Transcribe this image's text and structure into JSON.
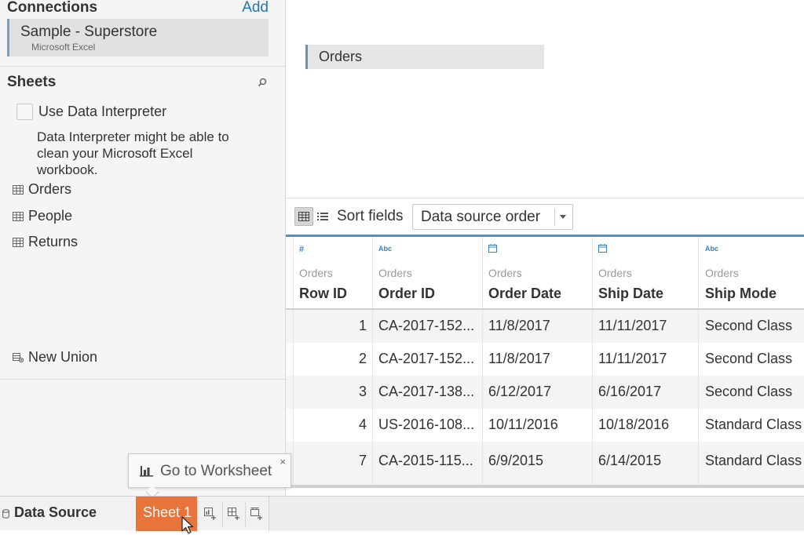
{
  "connections": {
    "title": "Connections",
    "add_label": "Add",
    "items": [
      {
        "name": "Sample - Superstore",
        "type": "Microsoft Excel"
      }
    ]
  },
  "sheets": {
    "title": "Sheets",
    "search_icon": "search-icon",
    "interpreter_label": "Use Data Interpreter",
    "interpreter_checked": false,
    "interpreter_desc": "Data Interpreter might be able to clean your Microsoft Excel workbook.",
    "items": [
      {
        "label": "Orders",
        "icon": "table-icon"
      },
      {
        "label": "People",
        "icon": "table-icon"
      },
      {
        "label": "Returns",
        "icon": "table-icon"
      }
    ],
    "new_union_label": "New Union"
  },
  "canvas": {
    "table_label": "Orders"
  },
  "grid_toolbar": {
    "sort_label": "Sort fields",
    "sort_value": "Data source order"
  },
  "grid": {
    "columns": [
      {
        "type_icon": "#",
        "source": "Orders",
        "name": "Row ID"
      },
      {
        "type_icon": "Abc",
        "source": "Orders",
        "name": "Order ID"
      },
      {
        "type_icon": "date-icon",
        "source": "Orders",
        "name": "Order Date"
      },
      {
        "type_icon": "date-icon",
        "source": "Orders",
        "name": "Ship Date"
      },
      {
        "type_icon": "Abc",
        "source": "Orders",
        "name": "Ship Mode"
      }
    ],
    "rows": [
      [
        "1",
        "CA-2017-152...",
        "11/8/2017",
        "11/11/2017",
        "Second Class"
      ],
      [
        "2",
        "CA-2017-152...",
        "11/8/2017",
        "11/11/2017",
        "Second Class"
      ],
      [
        "3",
        "CA-2017-138...",
        "6/12/2017",
        "6/16/2017",
        "Second Class"
      ],
      [
        "4",
        "US-2016-108...",
        "10/11/2016",
        "10/18/2016",
        "Standard Class"
      ],
      [
        "7",
        "CA-2015-115...",
        "6/9/2015",
        "6/14/2015",
        "Standard Class"
      ]
    ]
  },
  "tooltip": {
    "text": "Go to Worksheet",
    "close": "×"
  },
  "tabs": {
    "data_source_label": "Data Source",
    "sheet_label": "Sheet 1",
    "accent_color": "#e8743b"
  },
  "colors": {
    "connection_accent": "#7a9cc6",
    "grid_accent": "#4f91cd",
    "link": "#1f77b4"
  }
}
